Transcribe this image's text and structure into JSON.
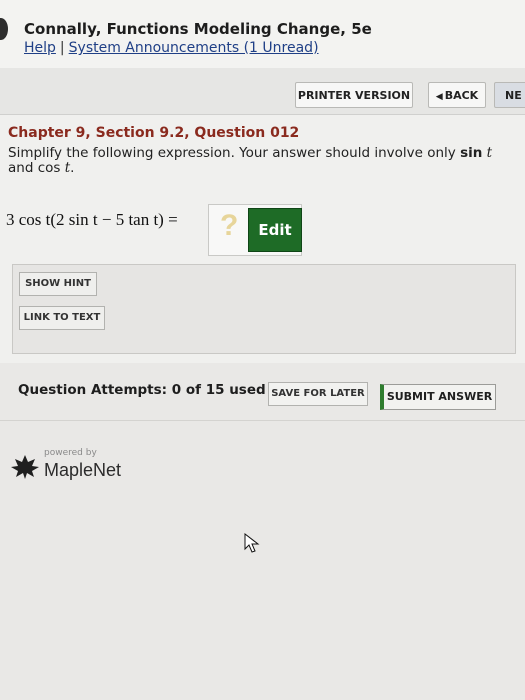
{
  "header": {
    "book_title": "Connally, Functions Modeling Change, 5e",
    "help_link": "Help",
    "separator": "|",
    "announcements_link": "System Announcements (1 Unread)"
  },
  "toolbar": {
    "printer_version": "PRINTER VERSION",
    "back_icon": "◀",
    "back": "BACK",
    "next": "NE"
  },
  "question": {
    "title": "Chapter 9, Section 9.2, Question 012",
    "text_part1": "Simplify the following expression. Your answer should involve only",
    "sin": "sin",
    "t1": "t",
    "and": "and",
    "cos": "cos",
    "t2": "t",
    "period": ".",
    "expression": "3 cos t(2 sin t − 5 tan t) =",
    "answer_placeholder": "?",
    "edit_button": "Edit"
  },
  "hints": {
    "show_hint": "SHOW HINT",
    "link_to_text": "LINK TO TEXT"
  },
  "actions": {
    "attempts_text": "Question Attempts: 0 of 15 used",
    "save_for_later": "SAVE FOR LATER",
    "submit_answer": "SUBMIT ANSWER"
  },
  "branding": {
    "powered_by": "powered by",
    "maplenet": "MapleNet"
  },
  "icons": {
    "brand": "maple-leaf-icon",
    "cursor": "mouse-cursor-icon"
  },
  "colors": {
    "edit_button": "#1e6b26",
    "question_title": "#8a2a1e",
    "link": "#1f3f86",
    "submit_accent": "#2f7d2f"
  }
}
